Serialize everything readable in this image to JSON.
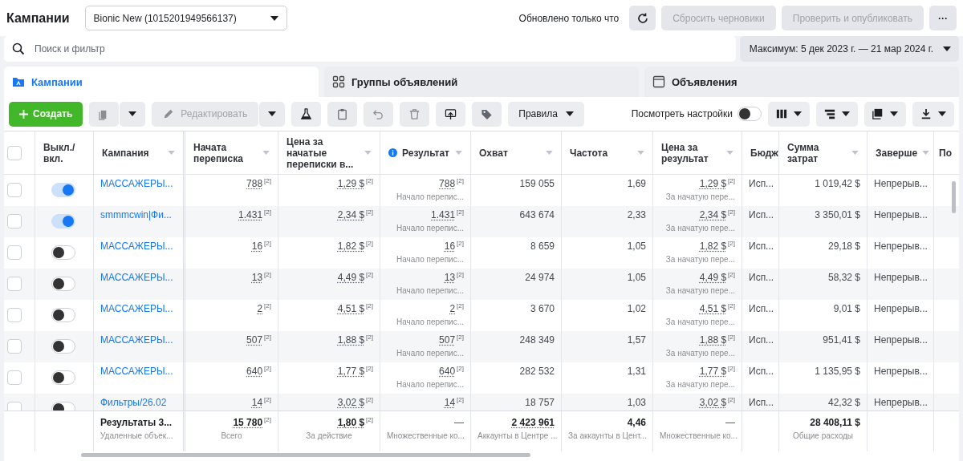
{
  "header": {
    "title": "Кампании",
    "account": "Bionic New (1015201949566137)",
    "updated": "Обновлено только что",
    "reset": {
      "label": "Сбросить черновики",
      "disabled": true
    },
    "publish": {
      "label": "Проверить и опубликовать",
      "disabled": true
    },
    "more": "···"
  },
  "search": {
    "placeholder": "Поиск и фильтр"
  },
  "date_range": "Максимум: 5 дек 2023 г. — 21 мар 2024 г.",
  "tabs": [
    {
      "label": "Кампании",
      "selected": true
    },
    {
      "label": "Группы объявлений",
      "selected": false
    },
    {
      "label": "Объявления",
      "selected": false
    }
  ],
  "toolbar": {
    "create": "Создать",
    "edit": {
      "label": "Редактировать",
      "disabled": true
    },
    "rules": "Правила",
    "settings": {
      "label": "Посмотреть настройки",
      "on": false
    }
  },
  "table": {
    "select_all": {
      "checked": false
    },
    "columns": [
      {
        "label": "Выкл./ вкл."
      },
      {
        "label": "Кампания",
        "sort": true
      },
      {
        "label": "Начата переписка",
        "sort": true
      },
      {
        "label": "Цена за начатые переписки в...",
        "sort": true
      },
      {
        "label": "Результат",
        "sort": true,
        "info": true
      },
      {
        "label": "Охват",
        "sort": true
      },
      {
        "label": "Частота",
        "sort": true
      },
      {
        "label": "Цена за результат",
        "sort": true
      },
      {
        "label": "Бюдж"
      },
      {
        "label": "Сумма затрат",
        "sort": true
      },
      {
        "label": "Заверше",
        "sort": true
      },
      {
        "label": "По"
      }
    ],
    "rows": [
      {
        "checked": false,
        "on": true,
        "name": "МАССАЖЕРЫ...",
        "started": {
          "value": "788",
          "note": "[2]"
        },
        "price": {
          "value": "1,29 $",
          "note": "[2]"
        },
        "result": {
          "value": "788",
          "note": "[2]",
          "sub": "Начало перепис..."
        },
        "reach": "159 055",
        "frequency": "1,69",
        "cost": {
          "value": "1,29 $",
          "note": "[2]",
          "sub": "За начатую пере..."
        },
        "budget": "Исп...",
        "spend": "1 019,42 $",
        "end": "Непрерыв..."
      },
      {
        "checked": false,
        "on": true,
        "name": "smmmcwin|Фи...",
        "started": {
          "value": "1.431",
          "note": "[2]"
        },
        "price": {
          "value": "2,34 $",
          "note": "[2]"
        },
        "result": {
          "value": "1.431",
          "note": "[2]",
          "sub": "Начало перепис..."
        },
        "reach": "643 674",
        "frequency": "2,33",
        "cost": {
          "value": "2,34 $",
          "note": "[2]",
          "sub": "За начатую пере..."
        },
        "budget": "Исп...",
        "spend": "3 350,01 $",
        "end": "Непрерыв..."
      },
      {
        "checked": false,
        "on": false,
        "name": "МАССАЖЕРЫ...",
        "started": {
          "value": "16",
          "note": "[2]"
        },
        "price": {
          "value": "1,82 $",
          "note": "[2]"
        },
        "result": {
          "value": "16",
          "note": "[2]",
          "sub": "Начало перепис..."
        },
        "reach": "8 659",
        "frequency": "1,05",
        "cost": {
          "value": "1,82 $",
          "note": "[2]",
          "sub": "За начатую пере..."
        },
        "budget": "Исп...",
        "spend": "29,18 $",
        "end": "Непрерыв..."
      },
      {
        "checked": false,
        "on": false,
        "name": "МАССАЖЕРЫ...",
        "started": {
          "value": "13",
          "note": "[2]"
        },
        "price": {
          "value": "4,49 $",
          "note": "[2]"
        },
        "result": {
          "value": "13",
          "note": "[2]",
          "sub": "Начало перепис..."
        },
        "reach": "24 974",
        "frequency": "1,05",
        "cost": {
          "value": "4,49 $",
          "note": "[2]",
          "sub": "За начатую пере..."
        },
        "budget": "Исп...",
        "spend": "58,32 $",
        "end": "Непрерыв..."
      },
      {
        "checked": false,
        "on": false,
        "name": "МАССАЖЕРЫ...",
        "started": {
          "value": "2",
          "note": "[2]"
        },
        "price": {
          "value": "4,51 $",
          "note": "[2]"
        },
        "result": {
          "value": "2",
          "note": "[2]",
          "sub": "Начало перепис..."
        },
        "reach": "3 670",
        "frequency": "1,02",
        "cost": {
          "value": "4,51 $",
          "note": "[2]",
          "sub": "За начатую пере..."
        },
        "budget": "Исп...",
        "spend": "9,01 $",
        "end": "Непрерыв..."
      },
      {
        "checked": false,
        "on": false,
        "name": "МАССАЖЕРЫ...",
        "started": {
          "value": "507",
          "note": "[2]"
        },
        "price": {
          "value": "1,88 $",
          "note": "[2]"
        },
        "result": {
          "value": "507",
          "note": "[2]",
          "sub": "Начало перепис..."
        },
        "reach": "248 349",
        "frequency": "1,57",
        "cost": {
          "value": "1,88 $",
          "note": "[2]",
          "sub": "За начатую пере..."
        },
        "budget": "Исп...",
        "spend": "951,41 $",
        "end": "Непрерыв..."
      },
      {
        "checked": false,
        "on": false,
        "name": "МАССАЖЕРЫ...",
        "started": {
          "value": "640",
          "note": "[2]"
        },
        "price": {
          "value": "1,77 $",
          "note": "[2]"
        },
        "result": {
          "value": "640",
          "note": "[2]",
          "sub": "Начало перепис..."
        },
        "reach": "282 532",
        "frequency": "1,31",
        "cost": {
          "value": "1,77 $",
          "note": "[2]",
          "sub": "За начатую пере..."
        },
        "budget": "Исп...",
        "spend": "1 135,95 $",
        "end": "Непрерыв..."
      },
      {
        "checked": false,
        "on": false,
        "name": "Фильтры/26.02",
        "started": {
          "value": "14",
          "note": "[2]"
        },
        "price": {
          "value": "3,02 $",
          "note": "[2]"
        },
        "result": {
          "value": "14",
          "note": "[2]"
        },
        "reach": "18 757",
        "frequency": "1,03",
        "cost": {
          "value": "3,02 $",
          "note": "[2]"
        },
        "budget": "Исп...",
        "spend": "42,32 $",
        "end": "Непрерыв..."
      }
    ],
    "totals": {
      "name": {
        "value": "Результаты 3...",
        "sub": "Удаленные объек..."
      },
      "started": {
        "value": "15 780",
        "note": "[2]",
        "sub": "Всего"
      },
      "price": {
        "value": "1,80 $",
        "note": "[2]",
        "sub": "За действие"
      },
      "result": {
        "value": "—",
        "sub": "Множественные ко..."
      },
      "reach": {
        "value": "2 423 961",
        "sub": "Аккаунты в Центре ..."
      },
      "frequency": {
        "value": "4,46",
        "sub": "За аккаунты в Цент..."
      },
      "cost": {
        "value": "—",
        "sub": "Множественные ко..."
      },
      "spend": {
        "value": "28 408,11 $",
        "sub": "Общие расходы"
      }
    }
  }
}
